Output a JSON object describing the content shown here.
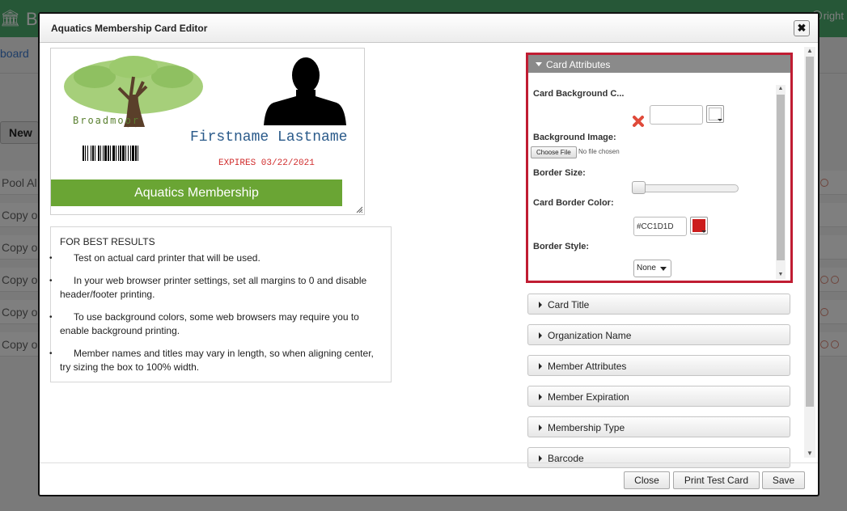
{
  "background": {
    "app_title_partial": "B",
    "copyright_partial": "right",
    "breadcrumb_partial": "board",
    "new_button_partial": "New",
    "rows": [
      "Pool Al",
      "Copy o",
      "Copy o",
      "Copy o",
      "Copy o",
      "Copy o"
    ]
  },
  "dialog": {
    "title": "Aquatics Membership Card Editor",
    "close_glyph": "✖"
  },
  "card": {
    "org_name": "Broadmoor",
    "member_name": "Firstname Lastname",
    "expires": "EXPIRES 03/22/2021",
    "title": "Aquatics Membership",
    "title_bg": "#6aa534",
    "expires_color": "#d02c2c",
    "name_color": "#2a5a8a"
  },
  "tips": {
    "heading": "FOR BEST RESULTS",
    "items": [
      "Test on actual card printer that will be used.",
      "In your web browser printer settings, set all margins to 0 and disable header/footer printing.",
      "To use background colors, some web browsers may require you to enable background printing.",
      "Member names and titles may vary in length, so when aligning center, try sizing the box to 100% width."
    ]
  },
  "accordion": {
    "open_panel": {
      "title": "Card Attributes",
      "card_bg_label": "Card Background C...",
      "card_bg_value": "",
      "bg_image_label": "Background Image:",
      "file_button": "Choose File",
      "file_status": "No file chosen",
      "border_size_label": "Border Size:",
      "border_size_value": 0,
      "border_color_label": "Card Border Color:",
      "border_color_value": "#CC1D1D",
      "border_style_label": "Border Style:",
      "border_style_value": "None"
    },
    "closed_panels": [
      "Card Title",
      "Organization Name",
      "Member Attributes",
      "Member Expiration",
      "Membership Type",
      "Barcode"
    ]
  },
  "footer": {
    "close_label": "Close",
    "print_label": "Print Test Card",
    "save_label": "Save"
  },
  "colors": {
    "header_green": "#4caf6e",
    "highlight_red": "#c01c32"
  }
}
